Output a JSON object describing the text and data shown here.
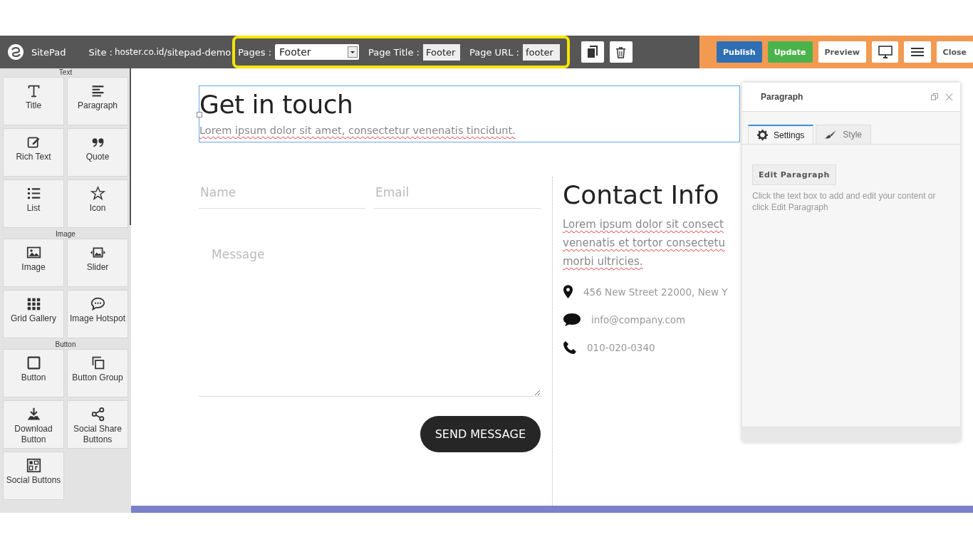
{
  "toolbar": {
    "brand": "SitePad",
    "site_label": "Site :",
    "site_domain": "hoster.co.id",
    "site_path": "/sitepad-demo",
    "pages_label": "Pages :",
    "pages_value": "Footer",
    "title_label": "Page Title :",
    "title_value": "Footer",
    "url_label": "Page URL :",
    "url_value": "footer",
    "actions": [
      {
        "label": "Publish",
        "kind": "primary"
      },
      {
        "label": "Update",
        "kind": "success"
      },
      {
        "label": "Preview",
        "kind": "plain"
      }
    ],
    "close": "Close"
  },
  "sidebar": {
    "groups": [
      {
        "title": "Text",
        "widgets": [
          "Title",
          "Paragraph",
          "Rich Text",
          "Quote",
          "List",
          "Icon"
        ]
      },
      {
        "title": "Image",
        "widgets": [
          "Image",
          "Slider",
          "Grid Gallery",
          "Image Hotspot"
        ]
      },
      {
        "title": "Button",
        "widgets": [
          "Button",
          "Button Group",
          "Download Button",
          "Social Share Buttons",
          "Social Buttons"
        ]
      }
    ]
  },
  "canvas": {
    "heading": "Get in touch",
    "intro": "Lorem ipsum dolor sit amet, consectetur venenatis tincidunt.",
    "form": {
      "name_placeholder": "Name",
      "email_placeholder": "Email",
      "message_placeholder": "Message",
      "submit": "SEND MESSAGE"
    },
    "contact": {
      "heading": "Contact Info",
      "lines": [
        "Lorem ipsum dolor sit consect",
        "venenatis et tortor consectetu",
        "morbi ultricies."
      ],
      "items": [
        {
          "kind": "address",
          "text": "456 New Street 22000, New Y"
        },
        {
          "kind": "email",
          "text": "info@company.com"
        },
        {
          "kind": "phone",
          "text": "010-020-0340"
        }
      ]
    }
  },
  "panel": {
    "title": "Paragraph",
    "tabs": [
      {
        "label": "Settings",
        "selected": true
      },
      {
        "label": "Style",
        "selected": false
      }
    ],
    "button": "Edit Paragraph",
    "help": "Click the text box to add and edit your content or click Edit Paragraph"
  }
}
